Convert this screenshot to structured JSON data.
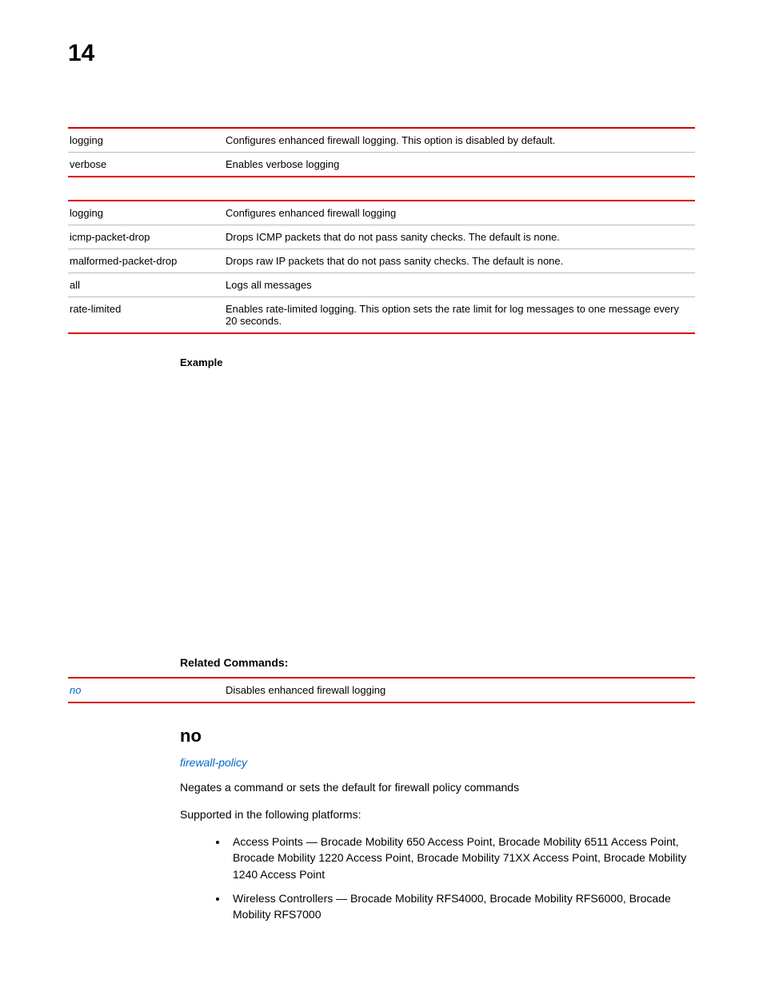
{
  "chapter": "14",
  "table1": [
    {
      "k": "logging",
      "v": "Configures enhanced firewall logging. This option is disabled by default."
    },
    {
      "k": "verbose",
      "v": "Enables verbose logging"
    }
  ],
  "table2": [
    {
      "k": "logging",
      "v": "Configures enhanced firewall logging"
    },
    {
      "k": "icmp-packet-drop",
      "v": "Drops ICMP packets that do not pass sanity checks. The default is none."
    },
    {
      "k": "malformed-packet-drop",
      "v": "Drops raw IP packets that do not pass sanity checks. The default is none."
    },
    {
      "k": "all",
      "v": "Logs all messages"
    },
    {
      "k": "rate-limited",
      "v": "Enables rate-limited logging. This option sets the rate limit for log messages to one message every 20 seconds."
    }
  ],
  "headings": {
    "example": "Example",
    "related": "Related Commands:",
    "command": "no"
  },
  "related_table": [
    {
      "k": "no",
      "v": "Disables enhanced firewall logging"
    }
  ],
  "section": {
    "link": "firewall-policy",
    "desc": "Negates a command or sets the default for firewall policy commands",
    "supported": "Supported in the following platforms:",
    "bullets": [
      "Access Points — Brocade Mobility 650 Access Point, Brocade Mobility 6511 Access Point, Brocade Mobility 1220 Access Point, Brocade Mobility 71XX Access Point, Brocade Mobility 1240 Access Point",
      "Wireless Controllers — Brocade Mobility RFS4000, Brocade Mobility RFS6000, Brocade Mobility RFS7000"
    ]
  }
}
